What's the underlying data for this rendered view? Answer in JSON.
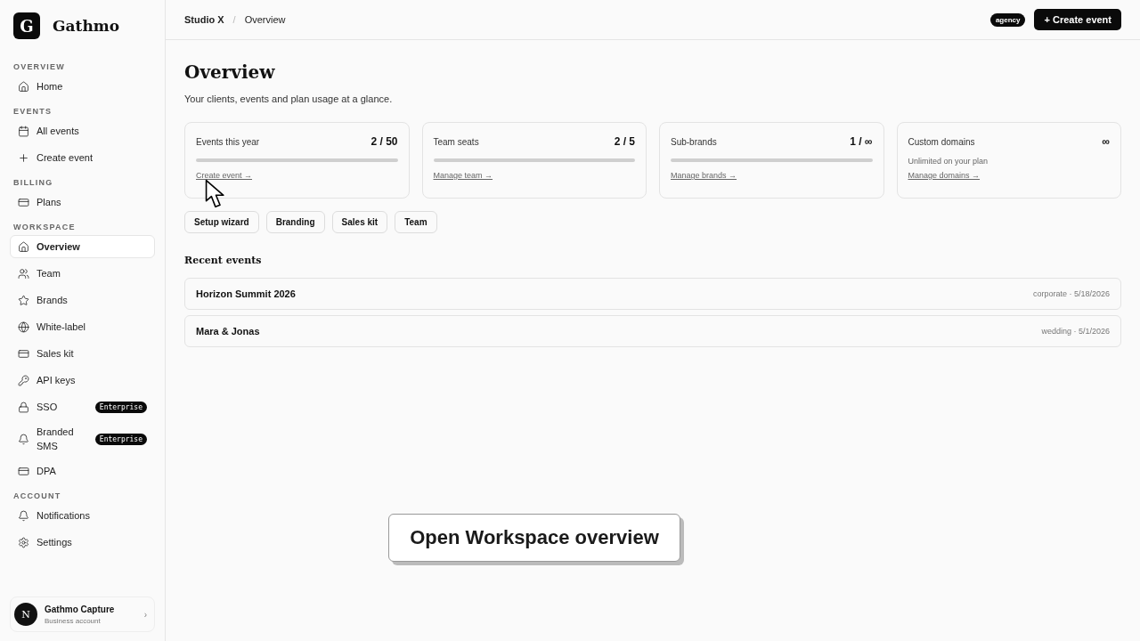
{
  "brand": {
    "logo_letter": "G",
    "name": "Gathmo"
  },
  "sidebar": {
    "sections": [
      {
        "title": "OVERVIEW",
        "items": [
          {
            "label": "Home",
            "kind": "home",
            "selected": false
          }
        ]
      },
      {
        "title": "EVENTS",
        "items": [
          {
            "label": "All events",
            "kind": "calendar",
            "selected": false
          },
          {
            "label": "Create event",
            "kind": "plus",
            "selected": false
          }
        ]
      },
      {
        "title": "BILLING",
        "items": [
          {
            "label": "Plans",
            "kind": "card",
            "selected": false
          }
        ]
      },
      {
        "title": "WORKSPACE",
        "items": [
          {
            "label": "Overview",
            "kind": "home",
            "selected": true
          },
          {
            "label": "Team",
            "kind": "users",
            "selected": false
          },
          {
            "label": "Brands",
            "kind": "star",
            "selected": false
          },
          {
            "label": "White-label",
            "kind": "globe",
            "selected": false
          },
          {
            "label": "Sales kit",
            "kind": "card",
            "selected": false
          },
          {
            "label": "API keys",
            "kind": "key",
            "selected": false
          },
          {
            "label": "SSO",
            "kind": "lock",
            "selected": false,
            "badge": "Enterprise"
          },
          {
            "label": "Branded SMS",
            "kind": "bell",
            "selected": false,
            "badge": "Enterprise"
          },
          {
            "label": "DPA",
            "kind": "card",
            "selected": false
          }
        ]
      },
      {
        "title": "ACCOUNT",
        "items": [
          {
            "label": "Notifications",
            "kind": "bell",
            "selected": false
          },
          {
            "label": "Settings",
            "kind": "gear",
            "selected": false
          }
        ]
      }
    ],
    "account": {
      "avatar_letter": "N",
      "name": "Gathmo Capture",
      "subtitle": "Business account",
      "chevron": "›"
    }
  },
  "topbar": {
    "breadcrumb": [
      "Studio X",
      "Overview"
    ],
    "separator": "/",
    "plan_badge": "agency",
    "create_button": "+ Create event"
  },
  "page": {
    "title": "Overview",
    "subtitle": "Your clients, events and plan usage at a glance."
  },
  "stats": [
    {
      "kind": "meter",
      "label": "Events this year",
      "value": "2 / 50",
      "link": "Create event →"
    },
    {
      "kind": "meter",
      "label": "Team seats",
      "value": "2 / 5",
      "link": "Manage team →"
    },
    {
      "kind": "meter",
      "label": "Sub-brands",
      "value": "1 / ∞",
      "link": "Manage brands →"
    },
    {
      "kind": "note",
      "label": "Custom domains",
      "value": "∞",
      "note": "Unlimited on your plan",
      "link": "Manage domains →"
    }
  ],
  "quick_links": [
    "Setup wizard",
    "Branding",
    "Sales kit",
    "Team"
  ],
  "recent_events": {
    "title": "Recent events",
    "rows": [
      {
        "name": "Horizon Summit 2026",
        "meta": "corporate · 5/18/2026"
      },
      {
        "name": "Mara & Jonas",
        "meta": "wedding · 5/1/2026"
      }
    ]
  },
  "callout": "Open Workspace overview"
}
